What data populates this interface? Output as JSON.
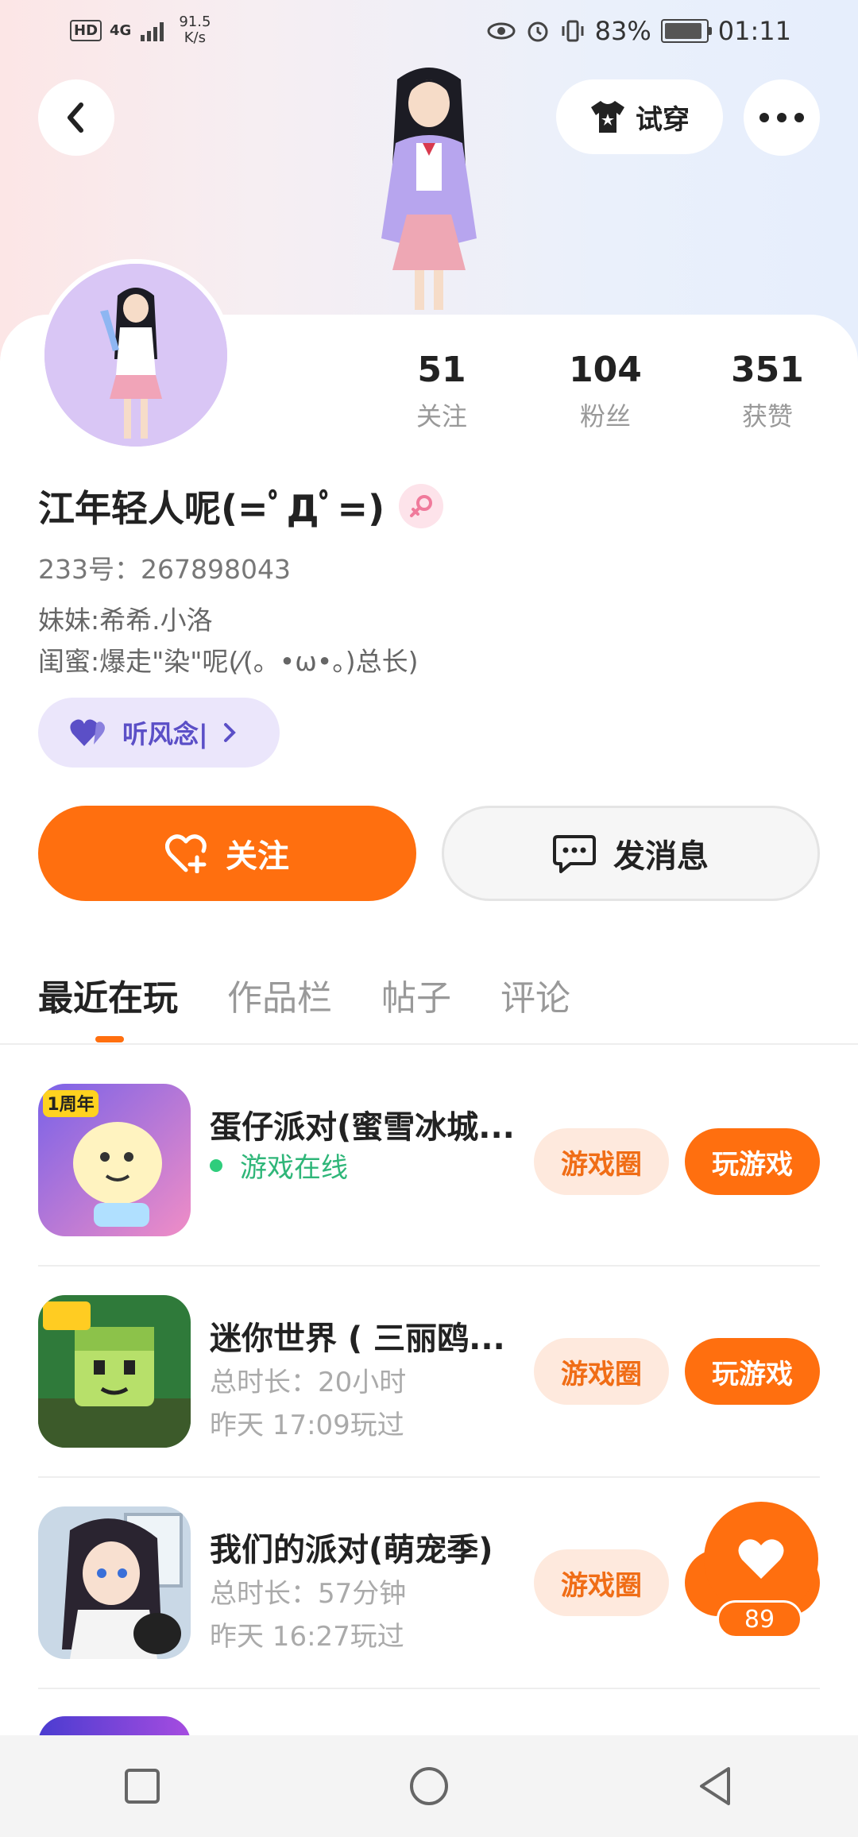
{
  "status_bar": {
    "hd": "HD",
    "network": "4G",
    "speed": "91.5",
    "speed_unit": "K/s",
    "battery": "83%",
    "time": "01:11"
  },
  "header": {
    "back_icon": "chevron-left-icon",
    "tryon_label": "试穿",
    "tryon_icon": "shirt-icon",
    "more_icon": "more-dots-icon"
  },
  "profile": {
    "name": "江年轻人呢(=ﾟДﾟ=)",
    "gender_icon": "female-icon",
    "uid": "233号：267898043",
    "bio_lines": [
      "妹妹:希希.小洛",
      "闺蜜:爆走\"染\"呢(⁄(。•ω•。)总长)"
    ],
    "tag_label": "听风念|",
    "tag_icon": "heart-pair-icon"
  },
  "stats": [
    {
      "num": "51",
      "label": "关注"
    },
    {
      "num": "104",
      "label": "粉丝"
    },
    {
      "num": "351",
      "label": "获赞"
    }
  ],
  "actions": {
    "follow_label": "关注",
    "message_label": "发消息"
  },
  "tabs": [
    "最近在玩",
    "作品栏",
    "帖子",
    "评论"
  ],
  "games": [
    {
      "title": "蛋仔派对(蜜雪冰城...",
      "status": "游戏在线",
      "circle_label": "游戏圈",
      "play_label": "玩游戏",
      "icon_badge": "1周年"
    },
    {
      "title": "迷你世界 ( 三丽鸥...",
      "duration": "总时长：20小时",
      "last_played": "昨天 17:09玩过",
      "circle_label": "游戏圈",
      "play_label": "玩游戏"
    },
    {
      "title": "我们的派对(萌宠季)",
      "duration": "总时长：57分钟",
      "last_played": "昨天 16:27玩过",
      "circle_label": "游戏圈"
    }
  ],
  "like_float": {
    "count": "89",
    "icon": "heart-icon"
  },
  "nav": {
    "recent_icon": "square-icon",
    "home_icon": "circle-icon",
    "back_icon": "triangle-back-icon"
  },
  "colors": {
    "accent": "#ff6f0f",
    "online": "#2fb679",
    "tag_bg": "#ebe6fb"
  }
}
